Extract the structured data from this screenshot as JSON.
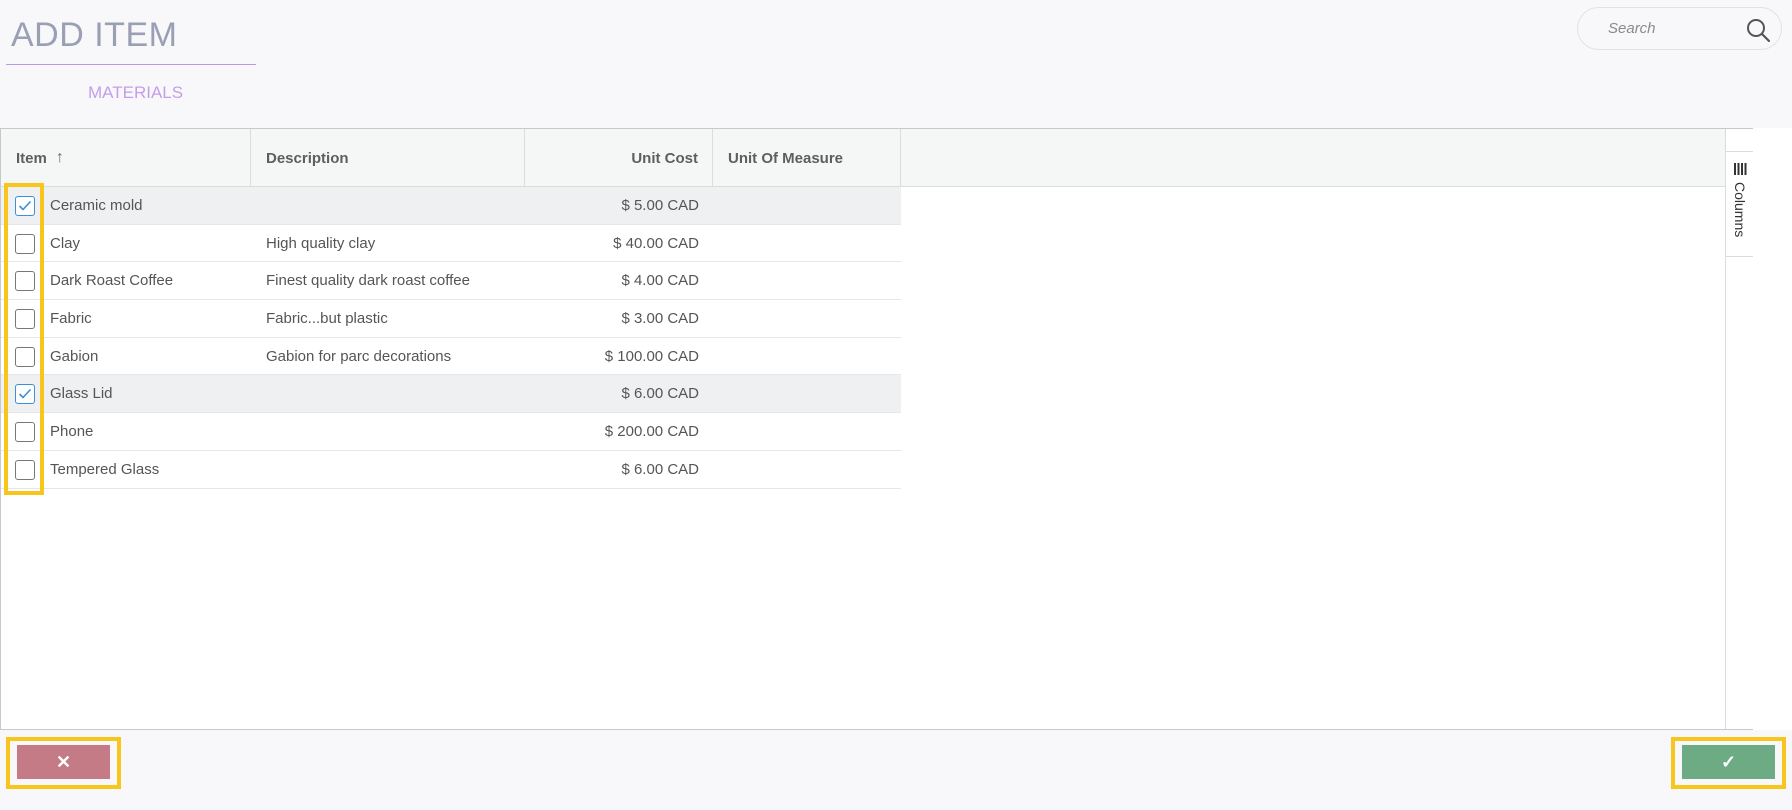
{
  "header": {
    "title": "ADD ITEM",
    "tab_label": "MATERIALS"
  },
  "search": {
    "placeholder": "Search",
    "value": ""
  },
  "grid": {
    "columns": [
      {
        "label": "Item",
        "sort": "ascending"
      },
      {
        "label": "Description"
      },
      {
        "label": "Unit Cost"
      },
      {
        "label": "Unit Of Measure"
      }
    ],
    "sort_arrow": "↑",
    "rows": [
      {
        "item": "Ceramic mold",
        "description": "",
        "unit_cost": "$ 5.00 CAD",
        "unit_of_measure": "",
        "checked": true
      },
      {
        "item": "Clay",
        "description": "High quality clay",
        "unit_cost": "$ 40.00 CAD",
        "unit_of_measure": "",
        "checked": false
      },
      {
        "item": "Dark Roast Coffee",
        "description": "Finest quality dark roast coffee",
        "unit_cost": "$ 4.00 CAD",
        "unit_of_measure": "",
        "checked": false
      },
      {
        "item": "Fabric",
        "description": "Fabric...but plastic",
        "unit_cost": "$ 3.00 CAD",
        "unit_of_measure": "",
        "checked": false
      },
      {
        "item": "Gabion",
        "description": "Gabion for parc decorations",
        "unit_cost": "$ 100.00 CAD",
        "unit_of_measure": "",
        "checked": false
      },
      {
        "item": "Glass Lid",
        "description": "",
        "unit_cost": "$ 6.00 CAD",
        "unit_of_measure": "",
        "checked": true
      },
      {
        "item": "Phone",
        "description": "",
        "unit_cost": "$ 200.00 CAD",
        "unit_of_measure": "",
        "checked": false
      },
      {
        "item": "Tempered Glass",
        "description": "",
        "unit_cost": "$ 6.00 CAD",
        "unit_of_measure": "",
        "checked": false
      }
    ],
    "side_panel_label": "Columns"
  },
  "footer": {
    "cancel_symbol": "✕",
    "confirm_symbol": "✓"
  },
  "colors": {
    "accent_purple": "#c49ee8",
    "cancel_button": "#c47b86",
    "confirm_button": "#6dab85",
    "highlight": "#f8c51c",
    "checkbox_checked": "#3d8fd8"
  },
  "icons": {
    "search": "search-icon",
    "columns": "columns-icon",
    "check": "check-icon",
    "cancel": "close-icon",
    "confirm": "checkmark-icon"
  }
}
